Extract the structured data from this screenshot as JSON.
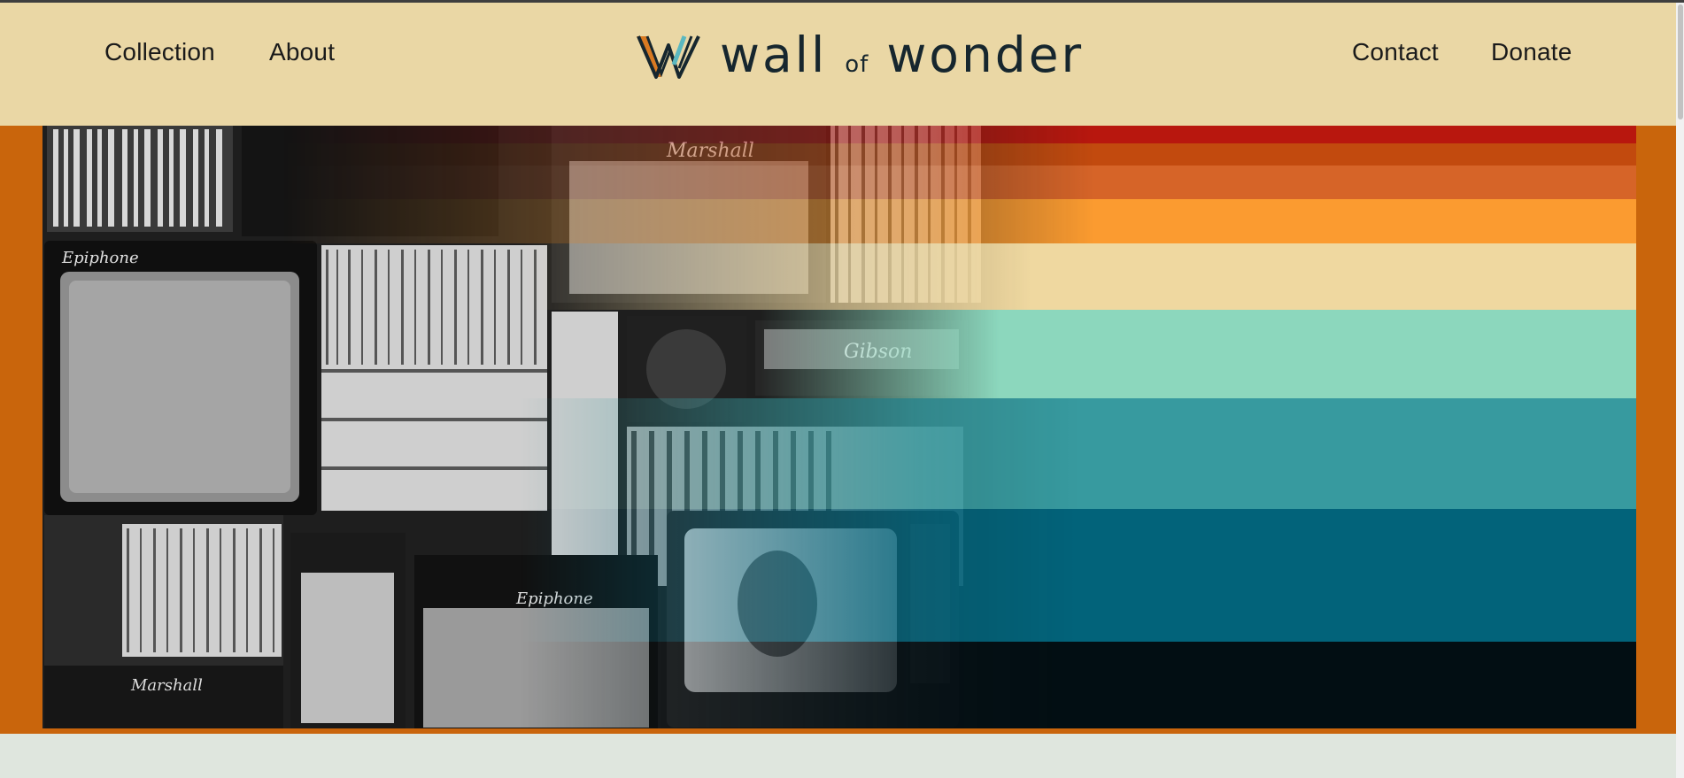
{
  "nav": {
    "left_links": [
      "Collection",
      "About"
    ],
    "right_links": [
      "Contact",
      "Donate"
    ]
  },
  "brand": {
    "word1": "wall",
    "word2": "of",
    "word3": "wonder"
  },
  "hero": {
    "image_description_icon": "vintage-music-wall-photo",
    "stripe_colors": [
      "#b8170e",
      "#c24a0e",
      "#d66428",
      "#fb9b30",
      "#efd8a0",
      "#8cd7bd",
      "#379a9f",
      "#02637a",
      "#020e13"
    ]
  },
  "colors": {
    "nav_bg": "#ead7a5",
    "frame_orange": "#c9650c",
    "page_bg": "#dfe6de"
  }
}
